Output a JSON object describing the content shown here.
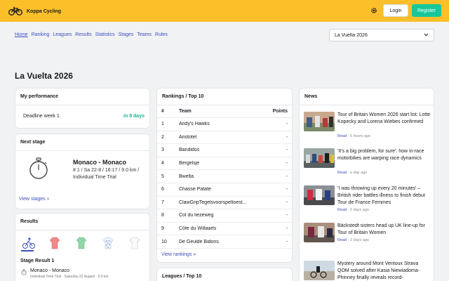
{
  "header": {
    "brand": "Koppa Cycling",
    "login_label": "Login",
    "register_label": "Register",
    "accent": "#fbbf2a",
    "register_color": "#16c79a"
  },
  "nav": {
    "items": [
      "Home",
      "Ranking",
      "Leagues",
      "Results",
      "Statistics",
      "Stages",
      "Teams",
      "Rules"
    ],
    "active": "Home",
    "race_select": "La Vuelta 2026"
  },
  "page_title": "La Vuelta 2026",
  "performance": {
    "title": "My performance",
    "deadline_label": "Deadline week 1",
    "deadline_value": "in 8 days"
  },
  "next_stage": {
    "title": "Next stage",
    "stage_name": "Monaco - Monaco",
    "stage_info": "# 1 / Sa 22-8 / 16:17 / 9.0 km / Individual Time Trial",
    "view_link": "View stages »",
    "icon": "stopwatch-icon"
  },
  "results": {
    "title": "Results",
    "jerseys": [
      "cyclist-icon",
      "red-jersey-icon",
      "green-jersey-icon",
      "polka-dot-jersey-icon",
      "white-jersey-icon"
    ],
    "stage_result_title": "Stage Result 1",
    "stage_name": "Monaco - Monaco",
    "stage_sub": "Individual Time Trial · Saturday 22 August · 9.0 km"
  },
  "rankings": {
    "title": "Rankings / Top 10",
    "columns": [
      "#",
      "Team",
      "Points"
    ],
    "rows": [
      {
        "rank": "1",
        "team": "Andy's Hawks",
        "points": "-"
      },
      {
        "rank": "2",
        "team": "Aristotel",
        "points": "-"
      },
      {
        "rank": "3",
        "team": "Bandidos",
        "points": "-"
      },
      {
        "rank": "4",
        "team": "Bergelsje",
        "points": "-"
      },
      {
        "rank": "5",
        "team": "Bwelta",
        "points": "-"
      },
      {
        "rank": "6",
        "team": "Chasse Patate",
        "points": "-"
      },
      {
        "rank": "7",
        "team": "ClawGripTegelsvoorspeltoest...",
        "points": "-"
      },
      {
        "rank": "8",
        "team": "Col du liezeweg",
        "points": "-"
      },
      {
        "rank": "9",
        "team": "Côte du Willaarts",
        "points": "-"
      },
      {
        "rank": "10",
        "team": "De Geulde Bidons",
        "points": "-"
      }
    ],
    "view_link": "View rankings »"
  },
  "leagues": {
    "title": "Leagues / Top 10"
  },
  "news": {
    "title": "News",
    "items": [
      {
        "title": "Tour of Britain Women 2026 start list: Lotte Kopecky and Lorena Wiebes confirmed",
        "read": "Read",
        "time": "5 hours ago"
      },
      {
        "title": "'It's a big problem, for sure': how in-race motorbikes are warping race dynamics",
        "read": "Read",
        "time": "a day ago"
      },
      {
        "title": "'I was throwing up every 20 minutes' – British rider battles illness to finish debut Tour de France Femmes",
        "read": "Read",
        "time": "2 days ago"
      },
      {
        "title": "Bäckstedt sisters head up UK line-up for Tour of Britain Women",
        "read": "Read",
        "time": "2 days ago"
      },
      {
        "title": "Mystery around Mont Ventoux Strava QOM solved after Kasia Niewiadoma-Phinney finally reveals record-",
        "read": "",
        "time": ""
      }
    ]
  }
}
